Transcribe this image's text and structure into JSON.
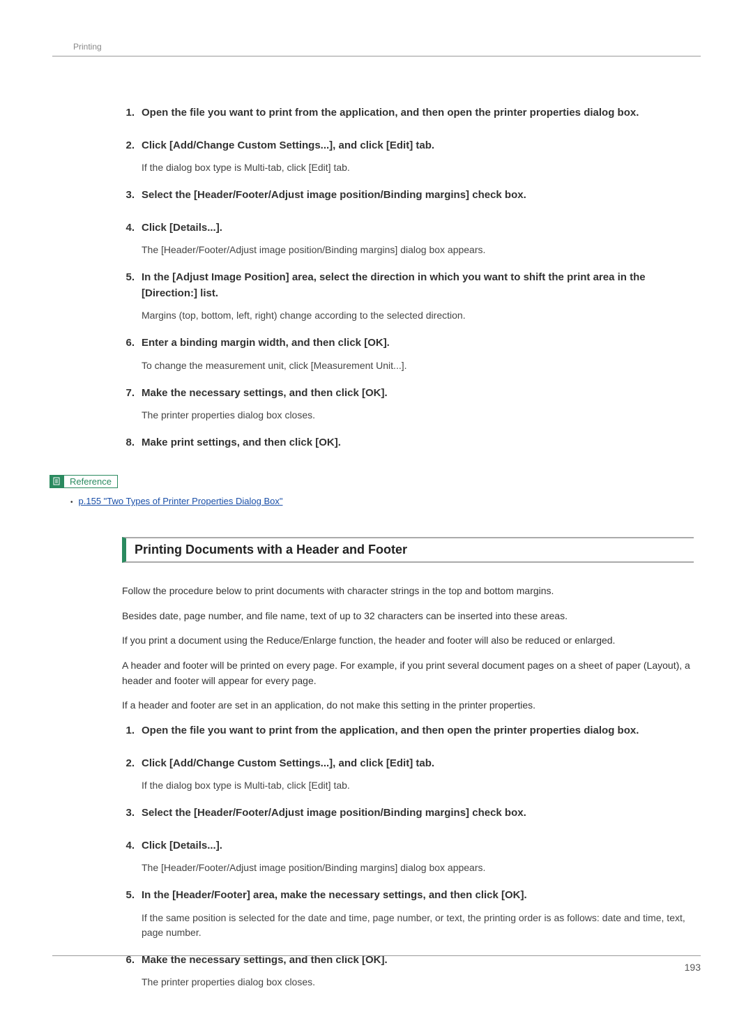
{
  "header": {
    "section": "Printing"
  },
  "list1": [
    {
      "num": "1.",
      "title": "Open the file you want to print from the application, and then open the printer properties dialog box.",
      "desc": ""
    },
    {
      "num": "2.",
      "title": "Click [Add/Change Custom Settings...], and click [Edit] tab.",
      "desc": "If the dialog box type is Multi-tab, click [Edit] tab."
    },
    {
      "num": "3.",
      "title": "Select the [Header/Footer/Adjust image position/Binding margins] check box.",
      "desc": ""
    },
    {
      "num": "4.",
      "title": "Click [Details...].",
      "desc": "The [Header/Footer/Adjust image position/Binding margins] dialog box appears."
    },
    {
      "num": "5.",
      "title": "In the [Adjust Image Position] area, select the direction in which you want to shift the print area in the [Direction:] list.",
      "desc": "Margins (top, bottom, left, right) change according to the selected direction."
    },
    {
      "num": "6.",
      "title": "Enter a binding margin width, and then click [OK].",
      "desc": "To change the measurement unit, click [Measurement Unit...]."
    },
    {
      "num": "7.",
      "title": "Make the necessary settings, and then click [OK].",
      "desc": "The printer properties dialog box closes."
    },
    {
      "num": "8.",
      "title": "Make print settings, and then click [OK].",
      "desc": ""
    }
  ],
  "reference": {
    "label": "Reference",
    "link": "p.155 \"Two Types of Printer Properties Dialog Box\""
  },
  "section2": {
    "heading": "Printing Documents with a Header and Footer",
    "paras": [
      "Follow the procedure below to print documents with character strings in the top and bottom margins.",
      "Besides date, page number, and file name, text of up to 32 characters can be inserted into these areas.",
      "If you print a document using the Reduce/Enlarge function, the header and footer will also be reduced or enlarged.",
      "A header and footer will be printed on every page. For example, if you print several document pages on a sheet of paper (Layout), a header and footer will appear for every page.",
      "If a header and footer are set in an application, do not make this setting in the printer properties."
    ]
  },
  "list2": [
    {
      "num": "1.",
      "title": " Open the file you want to print from the application, and then open the printer properties dialog box.",
      "desc": ""
    },
    {
      "num": "2.",
      "title": "Click [Add/Change Custom Settings...], and click [Edit] tab.",
      "desc": "If the dialog box type is Multi-tab, click [Edit] tab."
    },
    {
      "num": "3.",
      "title": "Select the [Header/Footer/Adjust image position/Binding margins] check box.",
      "desc": ""
    },
    {
      "num": "4.",
      "title": "Click [Details...].",
      "desc": "The [Header/Footer/Adjust image position/Binding margins] dialog box appears."
    },
    {
      "num": "5.",
      "title": "In the [Header/Footer] area, make the necessary settings, and then click [OK].",
      "desc": "If the same position is selected for the date and time, page number, or text, the printing order is as follows: date and time, text, page number."
    },
    {
      "num": "6.",
      "title": "Make the necessary settings, and then click [OK].",
      "desc": "The printer properties dialog box closes."
    }
  ],
  "footer": {
    "pageNum": "193"
  }
}
